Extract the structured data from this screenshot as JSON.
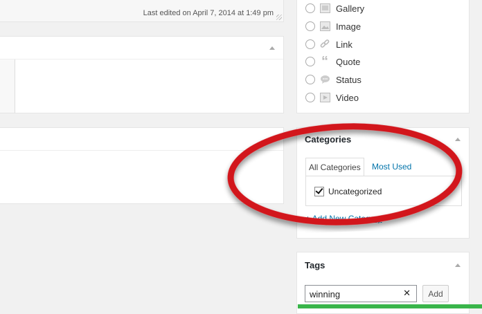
{
  "editor": {
    "last_edited": "Last edited on April 7, 2014 at 1:49 pm"
  },
  "format": {
    "items": [
      {
        "label": "Gallery",
        "icon": "gallery-icon"
      },
      {
        "label": "Image",
        "icon": "image-icon"
      },
      {
        "label": "Link",
        "icon": "link-icon"
      },
      {
        "label": "Quote",
        "icon": "quote-icon"
      },
      {
        "label": "Status",
        "icon": "status-icon"
      },
      {
        "label": "Video",
        "icon": "video-icon"
      }
    ]
  },
  "categories": {
    "title": "Categories",
    "tabs": [
      "All Categories",
      "Most Used"
    ],
    "items": [
      {
        "label": "Uncategorized",
        "checked": true
      }
    ],
    "add_new": "+ Add New Category"
  },
  "tags": {
    "title": "Tags",
    "input_value": "winning",
    "add_label": "Add",
    "clear_symbol": "✕"
  },
  "colors": {
    "highlight": "#d2161c",
    "link": "#0073aa",
    "bar": "#39b54a"
  }
}
